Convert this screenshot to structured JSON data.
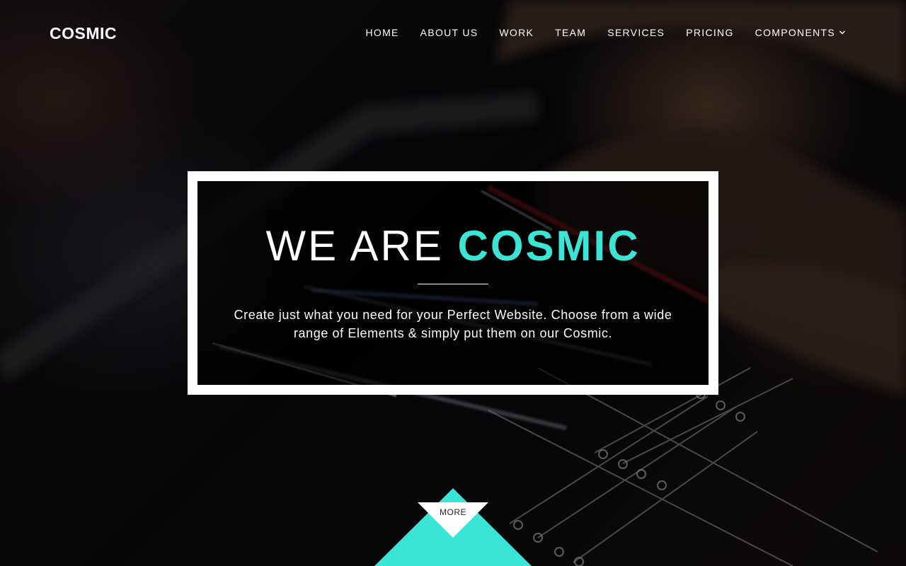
{
  "header": {
    "logo": "COSMIC",
    "nav": [
      {
        "label": "HOME"
      },
      {
        "label": "ABOUT US"
      },
      {
        "label": "WORK"
      },
      {
        "label": "TEAM"
      },
      {
        "label": "SERVICES"
      },
      {
        "label": "PRICING"
      },
      {
        "label": "COMPONENTS",
        "has_dropdown": true
      }
    ]
  },
  "hero": {
    "headline_light": "WE ARE ",
    "headline_accent": "COSMIC",
    "lead": "Create just what you need for your Perfect Website. Choose from a wide range of Elements & simply put them on our Cosmic.",
    "more_label": "MORE"
  },
  "colors": {
    "accent": "#3ae5d6",
    "text": "#ffffff",
    "background": "#000000"
  },
  "icons": {
    "dropdown": "chevron-down-icon"
  }
}
